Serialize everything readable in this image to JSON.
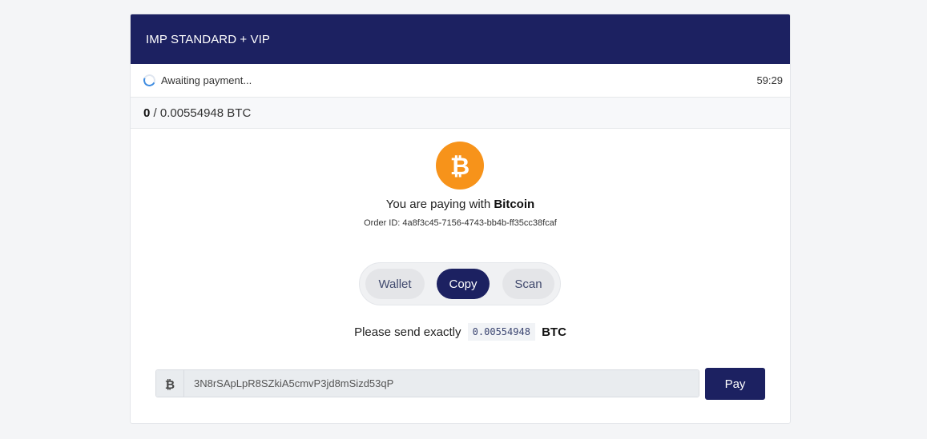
{
  "header": {
    "title": "IMP STANDARD + VIP"
  },
  "status": {
    "text": "Awaiting payment...",
    "timer": "59:29"
  },
  "amount": {
    "paid": "0",
    "separator": " / ",
    "total": "0.00554948 BTC"
  },
  "payment": {
    "intro": "You are paying with ",
    "currency_name": "Bitcoin",
    "order_id": "Order ID: 4a8f3c45-7156-4743-bb4b-ff35cc38fcaf"
  },
  "tabs": [
    {
      "label": "Wallet",
      "active": false
    },
    {
      "label": "Copy",
      "active": true
    },
    {
      "label": "Scan",
      "active": false
    }
  ],
  "send": {
    "prefix": "Please send exactly",
    "amount": "0.00554948",
    "unit": "BTC"
  },
  "address": {
    "value": "3N8rSApLpR8SZkiA5cmvP3jd8mSizd53qP"
  },
  "pay_button": {
    "label": "Pay"
  },
  "icons": {
    "currency": "bitcoin-icon",
    "loading": "spinner-icon"
  },
  "colors": {
    "brand": "#1c2161",
    "bitcoin": "#f7931a",
    "spinner": "#3d8be0"
  }
}
